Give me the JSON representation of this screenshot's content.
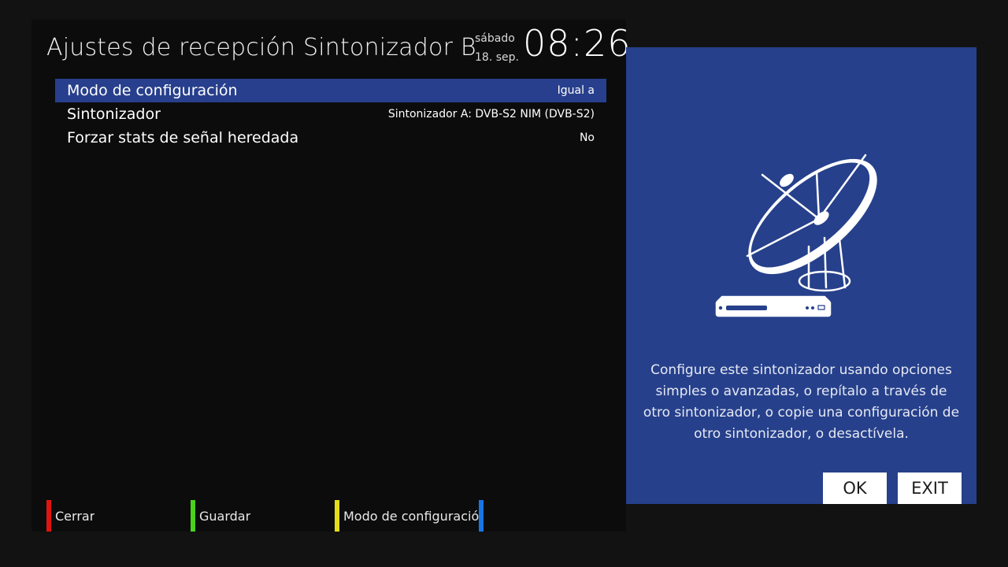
{
  "header": {
    "title": "Ajustes de recepción Sintonizador B",
    "day": "sábado",
    "date": "18. sep.",
    "time": "08:26"
  },
  "config": {
    "rows": [
      {
        "label": "Modo de configuración",
        "value": "Igual a",
        "selected": true
      },
      {
        "label": "Sintonizador",
        "value": "Sintonizador A: DVB-S2 NIM (DVB-S2)",
        "selected": false
      },
      {
        "label": "Forzar stats de señal heredada",
        "value": "No",
        "selected": false
      }
    ]
  },
  "color_buttons": {
    "red": {
      "label": "Cerrar",
      "color": "#e1150f"
    },
    "green": {
      "label": "Guardar",
      "color": "#4bd11b"
    },
    "yellow": {
      "label": "Modo de configuración",
      "color": "#e5dc19"
    },
    "blue": {
      "label": "",
      "color": "#1775e8"
    }
  },
  "help": {
    "icon": "satellite-dish-receiver-icon",
    "text": "Configure este sintonizador usando opciones simples o avanzadas, o repítalo a través de otro sintonizador, o copie una configuración de otro sintonizador, o desactívela.",
    "ok_label": "OK",
    "exit_label": "EXIT"
  },
  "colors": {
    "selection": "#273f8c",
    "help_panel": "#26408b",
    "background": "#121212"
  }
}
